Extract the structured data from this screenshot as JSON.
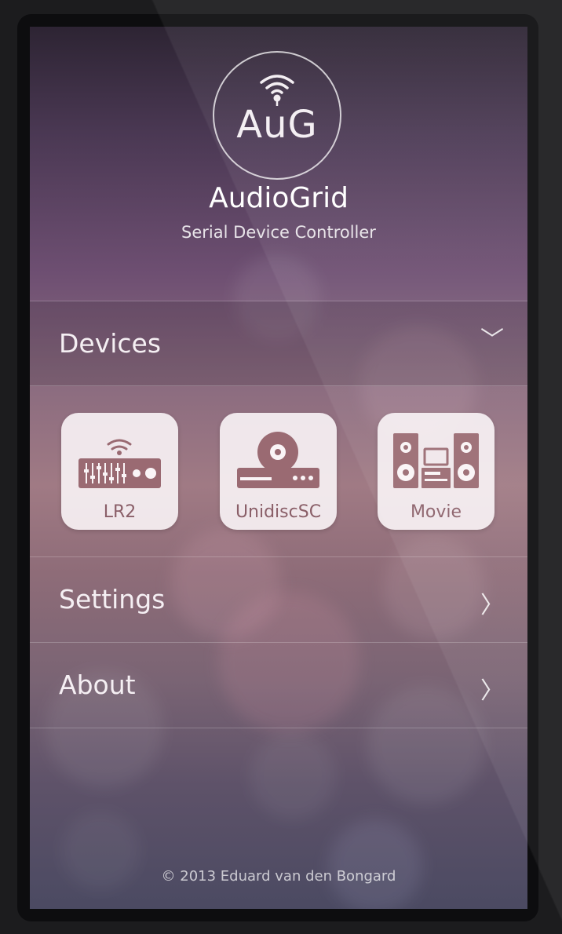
{
  "app": {
    "logo_text": "AuG",
    "title": "AudioGrid",
    "subtitle": "Serial Device Controller"
  },
  "menu": {
    "devices": {
      "label": "Devices",
      "chevron": "﹀"
    },
    "settings": {
      "label": "Settings",
      "chevron": "〉"
    },
    "about": {
      "label": "About",
      "chevron": "〉"
    }
  },
  "devices": [
    {
      "label": "LR2",
      "icon": "receiver-icon"
    },
    {
      "label": "UnidiscSC",
      "icon": "disc-player-icon"
    },
    {
      "label": "Movie",
      "icon": "speaker-system-icon"
    }
  ],
  "footer": {
    "copyright": "© 2013 Eduard van den Bongard"
  },
  "colors": {
    "accent_icon": "#9a6a72",
    "tile_background": "#faf4f6"
  }
}
